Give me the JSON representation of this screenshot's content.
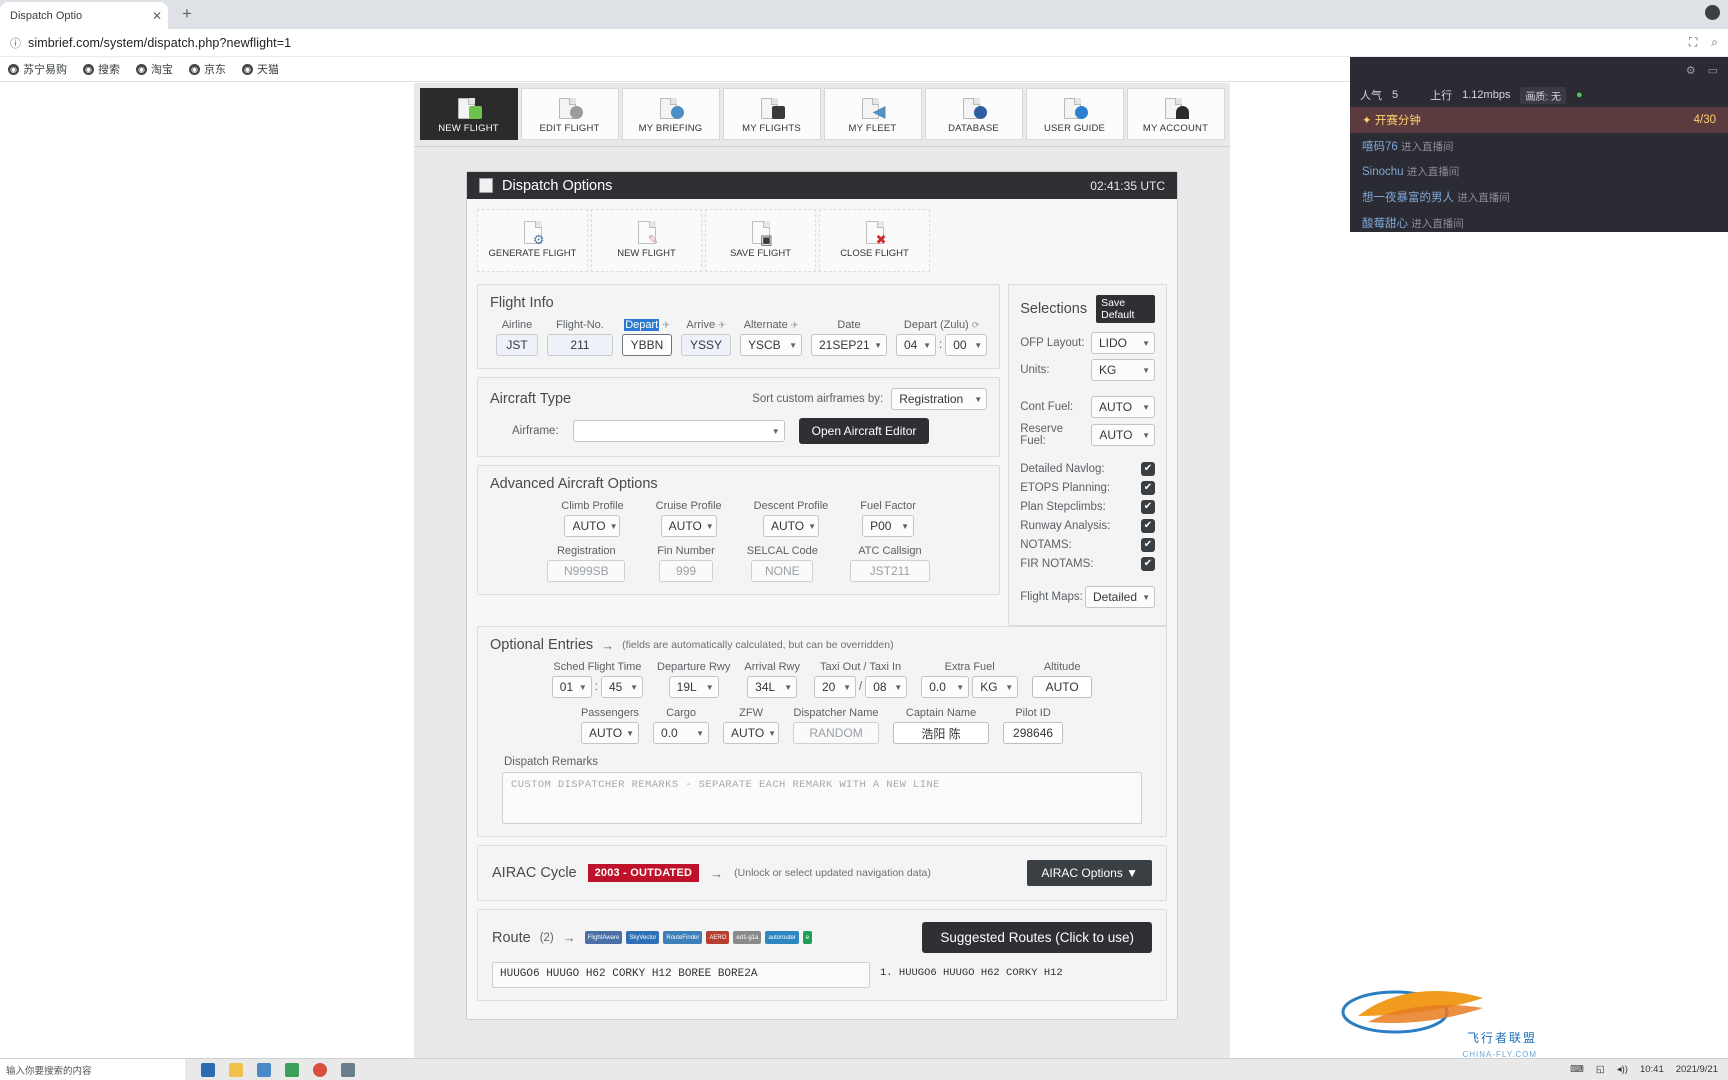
{
  "browser": {
    "tab_title": "Dispatch Optio",
    "new_tab_label": "+",
    "url": "simbrief.com/system/dispatch.php?newflight=1",
    "bookmarks": [
      "苏宁易购",
      "搜索",
      "淘宝",
      "京东",
      "天猫"
    ]
  },
  "nav_tabs": [
    {
      "label": "NEW FLIGHT",
      "active": true
    },
    {
      "label": "EDIT FLIGHT",
      "active": false
    },
    {
      "label": "MY BRIEFING",
      "active": false
    },
    {
      "label": "MY FLIGHTS",
      "active": false
    },
    {
      "label": "MY FLEET",
      "active": false
    },
    {
      "label": "DATABASE",
      "active": false
    },
    {
      "label": "USER GUIDE",
      "active": false
    },
    {
      "label": "MY ACCOUNT",
      "active": false
    }
  ],
  "dispatch": {
    "title": "Dispatch Options",
    "utc_time": "02:41:35 UTC",
    "actions": [
      {
        "label": "GENERATE FLIGHT",
        "icon": "gear-page-icon"
      },
      {
        "label": "NEW FLIGHT",
        "icon": "blank-page-icon"
      },
      {
        "label": "SAVE FLIGHT",
        "icon": "save-page-icon"
      },
      {
        "label": "CLOSE FLIGHT",
        "icon": "close-page-icon"
      }
    ]
  },
  "flight_info": {
    "title": "Flight Info",
    "labels": {
      "airline": "Airline",
      "flight_no": "Flight-No.",
      "depart": "Depart",
      "arrive": "Arrive",
      "alternate": "Alternate",
      "date": "Date",
      "depart_zulu": "Depart (Zulu)"
    },
    "values": {
      "airline": "JST",
      "flight_no": "211",
      "depart": "YBBN",
      "arrive": "YSSY",
      "alternate": "YSCB",
      "date": "21SEP21",
      "hour": "04",
      "minute": "00",
      "time_sep": ":"
    }
  },
  "aircraft_type": {
    "title": "Aircraft Type",
    "sort_label": "Sort custom airframes by:",
    "sort_value": "Registration",
    "airframe_label": "Airframe:",
    "airframe_value": "",
    "editor_button": "Open Aircraft Editor"
  },
  "advanced": {
    "title": "Advanced Aircraft Options",
    "fields": [
      {
        "label": "Climb Profile",
        "value": "AUTO",
        "type": "select"
      },
      {
        "label": "Cruise Profile",
        "value": "AUTO",
        "type": "select"
      },
      {
        "label": "Descent Profile",
        "value": "AUTO",
        "type": "select"
      },
      {
        "label": "Fuel Factor",
        "value": "P00",
        "type": "select"
      }
    ],
    "fields2": [
      {
        "label": "Registration",
        "value": "N999SB",
        "type": "text"
      },
      {
        "label": "Fin Number",
        "value": "999",
        "type": "text"
      },
      {
        "label": "SELCAL Code",
        "value": "NONE",
        "type": "text"
      },
      {
        "label": "ATC Callsign",
        "value": "JST211",
        "type": "text"
      }
    ]
  },
  "selections": {
    "title": "Selections",
    "save_default": "Save Default",
    "selects": [
      {
        "label": "OFP Layout:",
        "value": "LIDO"
      },
      {
        "label": "Units:",
        "value": "KG"
      }
    ],
    "selects2": [
      {
        "label": "Cont Fuel:",
        "value": "AUTO"
      },
      {
        "label": "Reserve Fuel:",
        "value": "AUTO"
      }
    ],
    "checkboxes": [
      {
        "label": "Detailed Navlog:",
        "checked": true
      },
      {
        "label": "ETOPS Planning:",
        "checked": true
      },
      {
        "label": "Plan Stepclimbs:",
        "checked": true
      },
      {
        "label": "Runway Analysis:",
        "checked": true
      },
      {
        "label": "NOTAMS:",
        "checked": true
      },
      {
        "label": "FIR NOTAMS:",
        "checked": true
      }
    ],
    "flight_maps": {
      "label": "Flight Maps:",
      "value": "Detailed"
    },
    "check_glyph": "✔"
  },
  "optional": {
    "title": "Optional Entries",
    "arrow": "→",
    "note": "(fields are automatically calculated, but can be overridden)",
    "row1": [
      {
        "label": "Sched Flight Time",
        "value": "01",
        "value2": "45",
        "sep": ":",
        "type": "double-select"
      },
      {
        "label": "Departure Rwy",
        "value": "19L",
        "type": "select"
      },
      {
        "label": "Arrival Rwy",
        "value": "34L",
        "type": "select"
      },
      {
        "label": "Taxi Out / Taxi In",
        "value": "20",
        "value2": "08",
        "sep": "/",
        "type": "double-select"
      },
      {
        "label": "Extra Fuel",
        "value": "0.0",
        "value2": "KG",
        "sep": "",
        "type": "double-select"
      },
      {
        "label": "Altitude",
        "value": "AUTO",
        "type": "text"
      }
    ],
    "row2": [
      {
        "label": "Passengers",
        "value": "AUTO",
        "type": "select"
      },
      {
        "label": "Cargo",
        "value": "0.0",
        "type": "select"
      },
      {
        "label": "ZFW",
        "value": "AUTO",
        "type": "select"
      },
      {
        "label": "Dispatcher Name",
        "value": "RANDOM",
        "type": "placeholder"
      },
      {
        "label": "Captain Name",
        "value": "浩阳 陈",
        "type": "text"
      },
      {
        "label": "Pilot ID",
        "value": "298646",
        "type": "text"
      }
    ],
    "remarks_label": "Dispatch Remarks",
    "remarks_placeholder": "CUSTOM DISPATCHER REMARKS - SEPARATE EACH REMARK WITH A NEW LINE"
  },
  "airac": {
    "title": "AIRAC Cycle",
    "badge": "2003 - OUTDATED",
    "arrow": "→",
    "note": "(Unlock or select updated navigation data)",
    "button": "AIRAC Options ▼"
  },
  "route": {
    "title": "Route",
    "count": "(2)",
    "arrow": "→",
    "chips": [
      {
        "label": "FlightAware",
        "color": "#4a6fa5"
      },
      {
        "label": "SkyVector",
        "color": "#2f6fb5"
      },
      {
        "label": "RouteFinder",
        "color": "#3d7fb8"
      },
      {
        "label": "AERO",
        "color": "#b5402f"
      },
      {
        "label": "ed1-g1a",
        "color": "#8a8a8a"
      },
      {
        "label": "autorouter",
        "color": "#2e86c1"
      },
      {
        "label": "e",
        "color": "#1f9e5a"
      }
    ],
    "suggested_button": "Suggested Routes (Click to use)",
    "route_value": "HUUGO6 HUUGO H62 CORKY H12 BOREE BORE2A",
    "suggestion_1": "1.  HUUGO6 HUUGO H62 CORKY H12"
  },
  "overlay": {
    "popularity_label": "人气",
    "popularity_value": "5",
    "uplink_label": "上行",
    "uplink_value": "1.12mbps",
    "quality_label": "画质: 无",
    "gift_title": "开赛分钟",
    "gift_count": "4/30",
    "messages": [
      {
        "name": "嘻码76",
        "action": "进入直播间"
      },
      {
        "name": "Sinochu",
        "action": "进入直播间"
      },
      {
        "name": "想一夜暴富的男人",
        "action": "进入直播间"
      },
      {
        "name": "酸莓甜心",
        "action": "进入直播间"
      }
    ]
  },
  "watermark": {
    "text": "飞行者联盟",
    "sub": "CHINA-FLY.COM"
  },
  "taskbar": {
    "search_placeholder": "输入你要搜索的内容",
    "tray_time": "10:41",
    "tray_date": "2021/9/21"
  }
}
